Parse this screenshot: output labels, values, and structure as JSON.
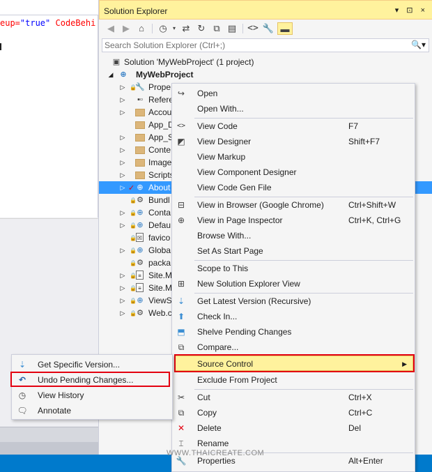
{
  "editor": {
    "code_line_red": "eup=",
    "code_line_val": "\"true\"",
    "code_line_blue": " CodeBehi"
  },
  "solution_explorer": {
    "title": "Solution Explorer",
    "title_buttons": "▾ ⊡ ×",
    "search_placeholder": "Search Solution Explorer (Ctrl+;)",
    "toolbar_icons": [
      "back-icon",
      "forward-icon",
      "home-icon",
      "history-icon",
      "sync-icon",
      "refresh-icon",
      "collapse-all-icon",
      "show-all-files-icon",
      "view-code-icon",
      "properties-wrench-icon",
      "pin-icon"
    ],
    "tree": [
      {
        "label": "Solution 'MyWebProject' (1 project)",
        "icon": "solution-icon"
      },
      {
        "label": "MyWebProject",
        "icon": "web-project-icon",
        "bold": true
      },
      {
        "label": "Prope",
        "icon": "wrench-icon"
      },
      {
        "label": "Refere",
        "icon": "references-icon"
      },
      {
        "label": "Accou",
        "icon": "folder-icon"
      },
      {
        "label": "App_D",
        "icon": "folder-icon"
      },
      {
        "label": "App_S",
        "icon": "folder-icon"
      },
      {
        "label": "Conte",
        "icon": "folder-icon"
      },
      {
        "label": "Image",
        "icon": "folder-icon"
      },
      {
        "label": "Scripts",
        "icon": "folder-icon"
      },
      {
        "label": "About",
        "icon": "web-file-icon",
        "selected": true
      },
      {
        "label": "Bundl",
        "icon": "config-file-icon"
      },
      {
        "label": "Conta",
        "icon": "web-file-icon"
      },
      {
        "label": "Defau",
        "icon": "web-file-icon"
      },
      {
        "label": "favico",
        "icon": "file-icon"
      },
      {
        "label": "Globa",
        "icon": "web-file-icon"
      },
      {
        "label": "packa",
        "icon": "file-icon"
      },
      {
        "label": "Site.M",
        "icon": "master-file-icon"
      },
      {
        "label": "Site.M",
        "icon": "master-file-icon"
      },
      {
        "label": "ViewS",
        "icon": "web-file-icon"
      },
      {
        "label": "Web.c",
        "icon": "config-file-icon"
      }
    ]
  },
  "context_menu": {
    "items": [
      {
        "label": "Open",
        "key": "",
        "icon": "open-icon"
      },
      {
        "label": "Open With...",
        "key": "",
        "icon": ""
      },
      {
        "label": "View Code",
        "key": "F7",
        "icon": "code-icon"
      },
      {
        "label": "View Designer",
        "key": "Shift+F7",
        "icon": "designer-icon"
      },
      {
        "label": "View Markup",
        "key": "",
        "icon": ""
      },
      {
        "label": "View Component Designer",
        "key": "",
        "icon": ""
      },
      {
        "label": "View Code Gen File",
        "key": "",
        "icon": ""
      },
      {
        "label": "View in Browser (Google Chrome)",
        "key": "Ctrl+Shift+W",
        "icon": "browser-icon"
      },
      {
        "label": "View in Page Inspector",
        "key": "Ctrl+K, Ctrl+G",
        "icon": "page-inspector-icon"
      },
      {
        "label": "Browse With...",
        "key": "",
        "icon": ""
      },
      {
        "label": "Set As Start Page",
        "key": "",
        "icon": ""
      },
      {
        "label": "Scope to This",
        "key": "",
        "icon": ""
      },
      {
        "label": "New Solution Explorer View",
        "key": "",
        "icon": "new-view-icon"
      },
      {
        "label": "Get Latest Version (Recursive)",
        "key": "",
        "icon": "get-latest-icon"
      },
      {
        "label": "Check In...",
        "key": "",
        "icon": "check-in-icon"
      },
      {
        "label": "Shelve Pending Changes",
        "key": "",
        "icon": "shelve-icon"
      },
      {
        "label": "Compare...",
        "key": "",
        "icon": "compare-icon"
      },
      {
        "label": "Source Control",
        "key": "",
        "icon": ""
      },
      {
        "label": "Exclude From Project",
        "key": "",
        "icon": ""
      },
      {
        "label": "Cut",
        "key": "Ctrl+X",
        "icon": "scissors-icon"
      },
      {
        "label": "Copy",
        "key": "Ctrl+C",
        "icon": "copy-icon"
      },
      {
        "label": "Delete",
        "key": "Del",
        "icon": "delete-icon"
      },
      {
        "label": "Rename",
        "key": "",
        "icon": "rename-icon"
      },
      {
        "label": "Properties",
        "key": "Alt+Enter",
        "icon": "wrench-icon"
      }
    ]
  },
  "submenu": {
    "items": [
      {
        "label": "Get Specific Version...",
        "icon": "get-specific-icon"
      },
      {
        "label": "Undo Pending Changes...",
        "icon": "undo-icon"
      },
      {
        "label": "View History",
        "icon": "history-icon"
      },
      {
        "label": "Annotate",
        "icon": "annotate-icon"
      }
    ]
  },
  "watermark": "WWW.THAICREATE.COM",
  "colors": {
    "accent_blue": "#007acc",
    "selection_blue": "#3399ff",
    "highlight_yellow": "#fff29d",
    "callout_red": "#e3000f"
  }
}
